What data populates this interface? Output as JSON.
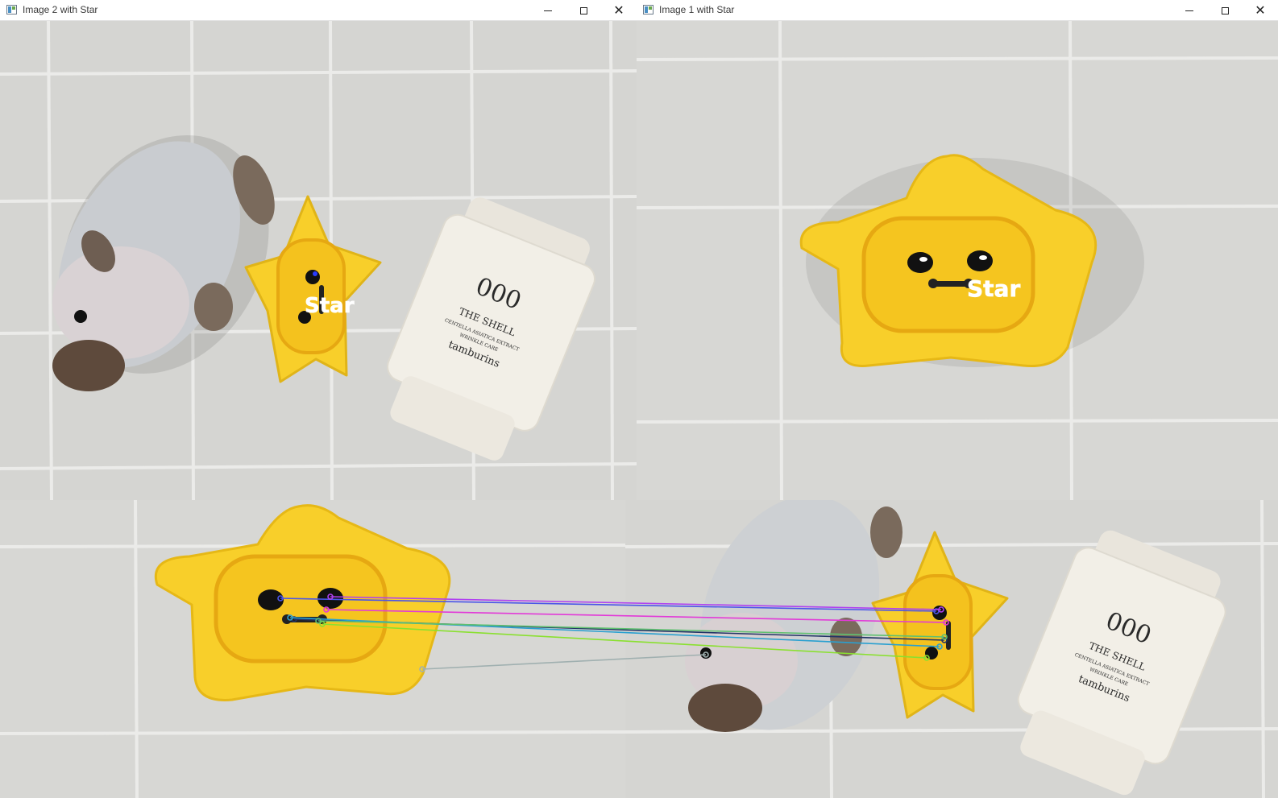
{
  "windows": [
    {
      "title": "Image 2 with Star",
      "label": "Star"
    },
    {
      "title": "Image 1 with Star",
      "label": "Star"
    }
  ],
  "jar": {
    "number": "000",
    "brand_line": "THE SHELL",
    "sub1": "CENTELLA ASIATICA EXTRACT",
    "sub2": "WRINKLE CARE",
    "maker": "tamburins"
  },
  "colors": {
    "star": "#f8cf2a",
    "tile": "#d6d6d3",
    "grout": "#ebebea",
    "jar": "#f2efe7",
    "titlebar": "#ffffff"
  },
  "matches_window": {
    "lines": [
      {
        "color": "#4a55e8"
      },
      {
        "color": "#e23ad8"
      },
      {
        "color": "#b040f0"
      },
      {
        "color": "#223366"
      },
      {
        "color": "#2aa0d0"
      },
      {
        "color": "#8ae030"
      },
      {
        "color": "#60c070"
      },
      {
        "color": "#a0b0b0"
      }
    ]
  },
  "icons": {
    "app": "opencv-window-icon",
    "minimize": "minimize-icon",
    "maximize": "maximize-icon",
    "close": "close-icon"
  }
}
